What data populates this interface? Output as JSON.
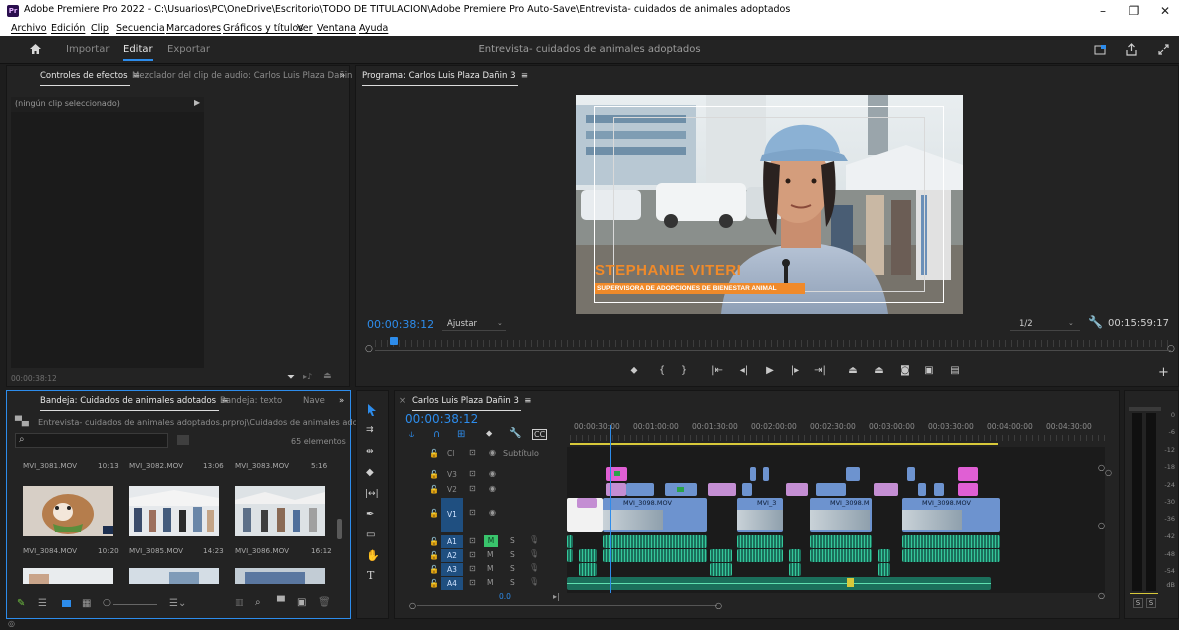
{
  "window": {
    "title": "Adobe Premiere Pro 2022 - C:\\Usuarios\\PC\\OneDrive\\Escritorio\\TODO DE TITULACION\\Adobe Premiere Pro Auto-Save\\Entrevista- cuidados de animales adoptados",
    "logo": "Pr",
    "controls": [
      "–",
      "❐",
      "✕"
    ]
  },
  "menu": [
    "Archivo",
    "Edición",
    "Clip",
    "Secuencia",
    "Marcadores",
    "Gráficos y títulos",
    "Ver",
    "Ventana",
    "Ayuda"
  ],
  "workspace": {
    "items": [
      "Importar",
      "Editar",
      "Exportar"
    ],
    "active": "Editar",
    "project_title": "Entrevista- cuidados de animales adoptados"
  },
  "effect_controls": {
    "tab_active": "Controles de efectos",
    "tab_mixer": "Mezclador del clip de audio: Carlos Luis Plaza Dañin",
    "no_clip": "(ningún clip seleccionado)",
    "timecode": "00:00:38:12"
  },
  "program": {
    "tab": "Programa: Carlos Luis Plaza Dañin 3",
    "timecode": "00:00:38:12",
    "fit": "Ajustar",
    "resolution": "1/2",
    "duration": "00:15:59:17",
    "lower_third_name": "STEPHANIE VITERI",
    "lower_third_role": "SUPERVISORA DE ADOPCIONES DE BIENESTAR ANIMAL"
  },
  "project": {
    "tab_active": "Bandeja: Cuidados de animales adotados",
    "tab2": "Bandeja: texto",
    "tab3": "Nave",
    "path": "Entrevista- cuidados de animales adoptados.prproj\\Cuidados de animales adotados",
    "count": "65 elementos",
    "search_placeholder": "",
    "items_row1": [
      {
        "name": "MVI_3081.MOV",
        "dur": "10:13"
      },
      {
        "name": "MVI_3082.MOV",
        "dur": "13:06"
      },
      {
        "name": "MVI_3083.MOV",
        "dur": "5:16"
      }
    ],
    "items_row2": [
      {
        "name": "MVI_3084.MOV",
        "dur": "10:20"
      },
      {
        "name": "MVI_3085.MOV",
        "dur": "14:23"
      },
      {
        "name": "MVI_3086.MOV",
        "dur": "16:12"
      }
    ]
  },
  "timeline": {
    "tab": "Carlos Luis Plaza Dañin 3",
    "timecode": "00:00:38:12",
    "ruler": [
      "00:00:30:00",
      "00:01:00:00",
      "00:01:30:00",
      "00:02:00:00",
      "00:02:30:00",
      "00:03:00:00",
      "00:03:30:00",
      "00:04:00:00",
      "00:04:30:00"
    ],
    "subtitle_track": "Subtítulo",
    "cl_label": "Cl",
    "video_tracks": [
      "V3",
      "V2",
      "V1"
    ],
    "audio_tracks": [
      "A1",
      "A2",
      "A3",
      "A4"
    ],
    "master_value": "0.0",
    "clip_labels": [
      "MVI_3098.MOV",
      "MVI_3",
      "MVI_3098.M",
      "MVI_3098.MOV"
    ],
    "m_label": "M",
    "s_label": "S"
  },
  "meter": {
    "scale": [
      "0",
      "-6",
      "-12",
      "-18",
      "-24",
      "-30",
      "-36",
      "-42",
      "-48",
      "-54",
      "dB"
    ],
    "solo": [
      "S",
      "S"
    ]
  },
  "colors": {
    "accent": "#2d8ceb",
    "video_clip": "#6d93cf",
    "purple_clip": "#c48ed3",
    "audio_clip": "#1b6f5b",
    "lower_third": "#f08a2a"
  }
}
